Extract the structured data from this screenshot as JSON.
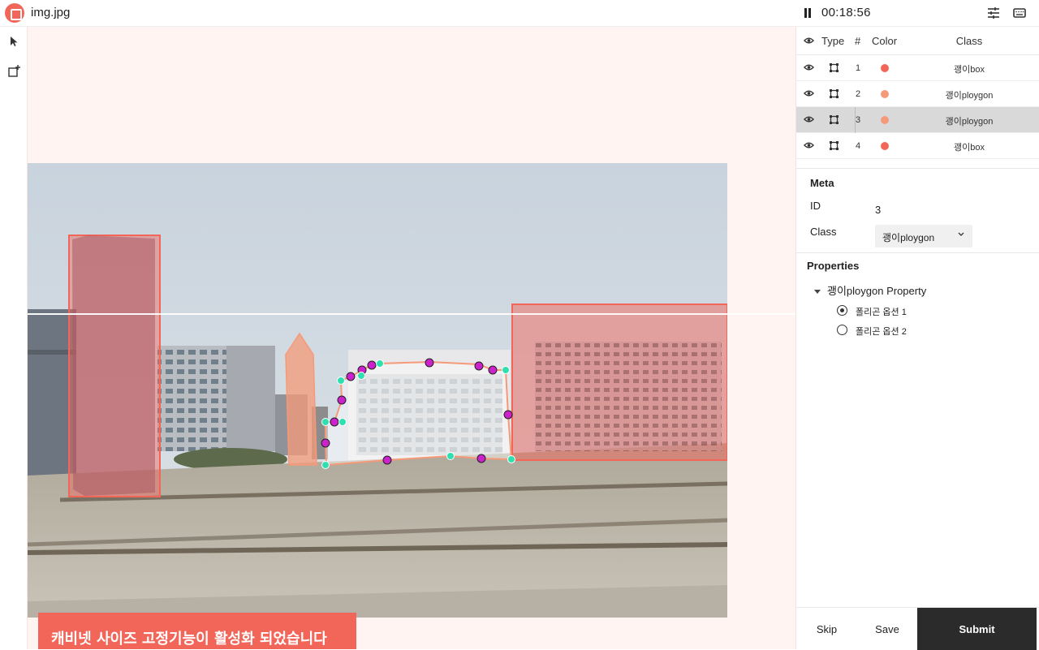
{
  "header": {
    "filename": "img.jpg",
    "timer": "00:18:56",
    "icons": [
      "logo-icon",
      "pause-icon",
      "sliders-icon",
      "keyboard-icon"
    ]
  },
  "toolbar": {
    "tools": [
      "pointer-icon",
      "add-box-icon"
    ]
  },
  "toast": {
    "message": "캐비넷 사이즈 고정기능이 활성화 되었습니다"
  },
  "table": {
    "headers": {
      "type": "Type",
      "num": "#",
      "color": "Color",
      "class": "Class"
    },
    "rows": [
      {
        "num": "1",
        "color": "#f2665a",
        "class": "괭이box"
      },
      {
        "num": "2",
        "color": "#f59a78",
        "class": "괭이ploygon"
      },
      {
        "num": "3",
        "color": "#f59a78",
        "class": "괭이ploygon",
        "selected": true
      },
      {
        "num": "4",
        "color": "#f2665a",
        "class": "괭이box"
      }
    ]
  },
  "meta": {
    "title": "Meta",
    "id_label": "ID",
    "id_value": "3",
    "class_label": "Class",
    "class_value": "괭이ploygon"
  },
  "properties": {
    "title": "Properties",
    "group": "괭이ploygon Property",
    "options": [
      {
        "label": "폴리곤 옵션 1",
        "checked": true
      },
      {
        "label": "폴리곤 옵션 2",
        "checked": false
      }
    ]
  },
  "footer": {
    "skip": "Skip",
    "save": "Save",
    "submit": "Submit"
  },
  "colors": {
    "accent": "#f2665a",
    "polygon": "#f59a78",
    "submit_bg": "#2b2b2b"
  }
}
